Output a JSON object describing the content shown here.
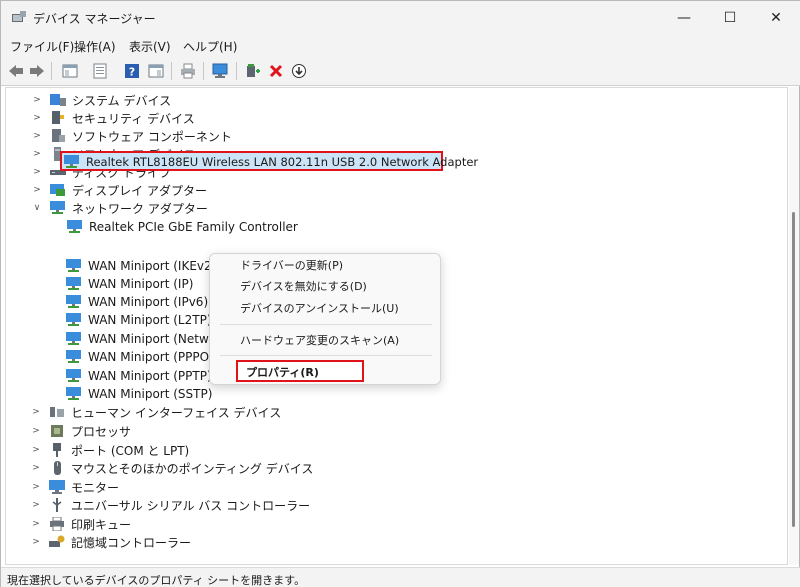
{
  "window": {
    "title": "デバイス マネージャー",
    "minimize": "—",
    "maximize": "☐",
    "close": "✕"
  },
  "menu": [
    "ファイル(F)",
    "操作(A)",
    "表示(V)",
    "ヘルプ(H)"
  ],
  "tree": {
    "categories_top": [
      "システム デバイス",
      "セキュリティ デバイス",
      "ソフトウェア コンポーネント",
      "ソフトウェア デバイス",
      "ディスク ドライブ",
      "ディスプレイ アダプター",
      "ネットワーク アダプター"
    ],
    "network_children": [
      "Realtek PCIe GbE Family Controller",
      "Realtek RTL8188EU Wireless LAN 802.11n USB 2.0 Network Adapter",
      "WAN Miniport (IKEv2)",
      "WAN Miniport (IP)",
      "WAN Miniport (IPv6)",
      "WAN Miniport (L2TP)",
      "WAN Miniport (Networ",
      "WAN Miniport (PPPOE)",
      "WAN Miniport (PPTP)",
      "WAN Miniport (SSTP)"
    ],
    "categories_bottom": [
      "ヒューマン インターフェイス デバイス",
      "プロセッサ",
      "ポート (COM と LPT)",
      "マウスとそのほかのポインティング デバイス",
      "モニター",
      "ユニバーサル シリアル バス コントローラー",
      "印刷キュー",
      "記憶域コントローラー"
    ]
  },
  "context_menu": {
    "update_driver": "ドライバーの更新(P)",
    "disable": "デバイスを無効にする(D)",
    "uninstall": "デバイスのアンインストール(U)",
    "scan": "ハードウェア変更のスキャン(A)",
    "properties": "プロパティ(R)"
  },
  "status": "現在選択しているデバイスのプロパティ シートを開きます。",
  "colors": {
    "highlight_border": "#e0131a",
    "selection": "#cce4f7"
  }
}
